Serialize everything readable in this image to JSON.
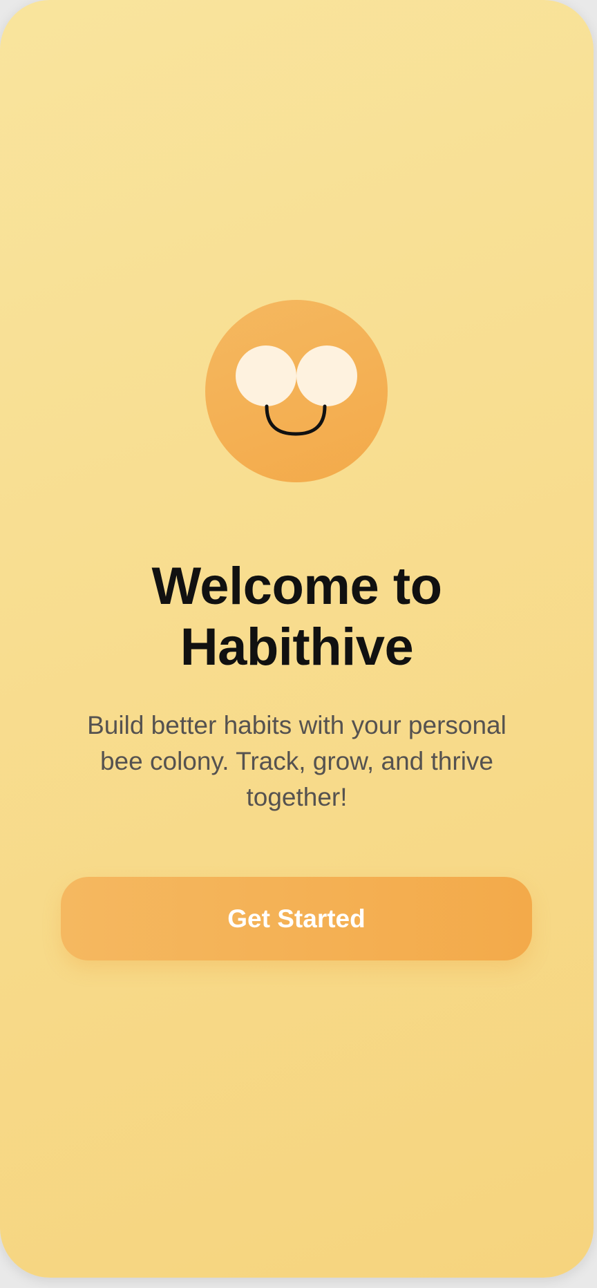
{
  "colors": {
    "background_top": "#F9E49D",
    "background_bottom": "#F6D47E",
    "accent": "#F3AA4A",
    "accent_light": "#F5B860",
    "eye_white": "#FEF2DF",
    "smile": "#111111"
  },
  "mascot": {
    "icon": "bee-face-icon"
  },
  "welcome": {
    "title_line1": "Welcome to",
    "title_line2": "Habithive",
    "subtitle": "Build better habits with your personal bee colony. Track, grow, and thrive together!"
  },
  "actions": {
    "get_started_label": "Get Started"
  }
}
